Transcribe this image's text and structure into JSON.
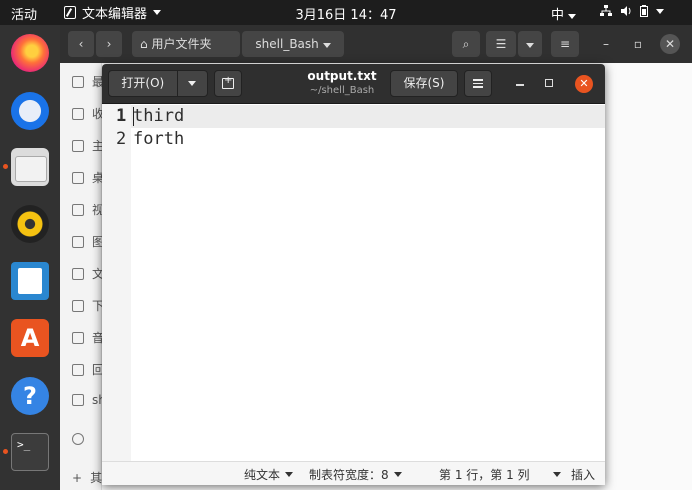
{
  "topbar": {
    "activities": "活动",
    "app_name": "文本编辑器",
    "clock": "3月16日  14：47",
    "input_method": "中"
  },
  "dock": {
    "items": [
      "firefox-icon",
      "thunderbird-icon",
      "files-icon",
      "rhythmbox-icon",
      "libreoffice-writer-icon",
      "ubuntu-software-icon",
      "help-icon",
      "terminal-icon"
    ],
    "terminal_prompt": ">_",
    "help_glyph": "?",
    "software_glyph": "A"
  },
  "files_window": {
    "path_home": "用户文件夹",
    "path_current": "shell_Bash",
    "sidebar": [
      "最",
      "收",
      "主",
      "桌",
      "视",
      "图",
      "文",
      "下",
      "音",
      "回",
      "sh",
      "",
      "其"
    ]
  },
  "gedit": {
    "open_label": "打开(O)",
    "file_name": "output.txt",
    "file_path": "~/shell_Bash",
    "save_label": "保存(S)",
    "lines": [
      {
        "num": "1",
        "text": "third"
      },
      {
        "num": "2",
        "text": "forth"
      }
    ],
    "status": {
      "language": "纯文本",
      "tab_width": "制表符宽度：8",
      "position": "第 1 行，第 1 列",
      "mode": "插入"
    }
  },
  "colors": {
    "accent": "#e95420",
    "header_dark": "#2f2f2f",
    "topbar": "#1d1d1d"
  }
}
